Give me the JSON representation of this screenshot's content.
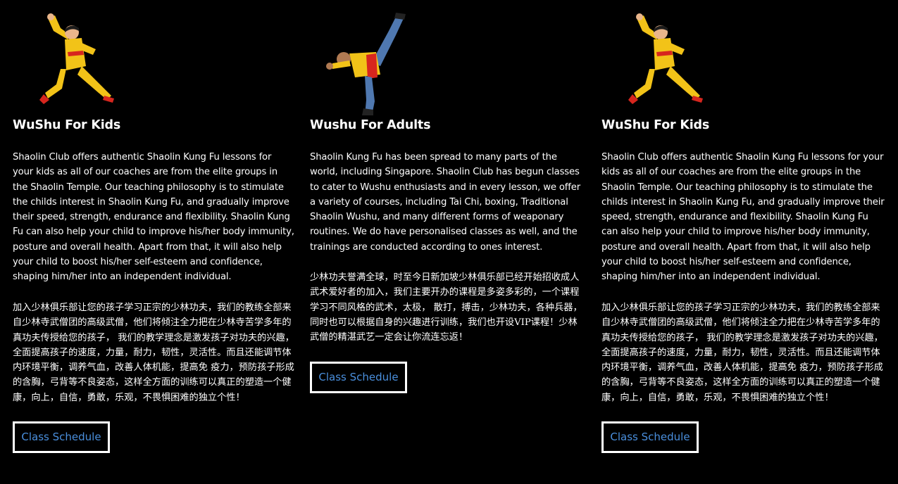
{
  "cards": [
    {
      "title": "WuShu For Kids",
      "description_en": "Shaolin Club offers authentic Shaolin Kung Fu lessons for your kids as all of our coaches are from the elite groups in the Shaolin Temple. Our teaching philosophy is to stimulate the childs interest in Shaolin Kung Fu, and gradually improve their speed, strength, endurance and flexibility. Shaolin Kung Fu can also help your child to improve his/her body immunity, posture and overall health. Apart from that, it will also help your child to boost his/her self-esteem and confidence, shaping him/her into an independent individual.",
      "description_zh": "加入少林俱乐部让您的孩子学习正宗的少林功夫，我们的教练全部来自少林寺武僧团的高级武僧，他们将倾注全力把在少林寺苦学多年的真功夫传授给您的孩子， 我们的教学理念是激发孩子对功夫的兴趣，全面提高孩子的速度，力量，耐力，韧性，灵活性。而且还能调节体内环境平衡，调养气血，改善人体机能，提高免 疫力，预防孩子形成的含胸，弓背等不良姿态，这样全方面的训练可以真正的塑造一个健康，向上，自信，勇敢，乐观，不畏惧困难的独立个性！",
      "button_label": "Class Schedule",
      "image": "kid-martial-artist-pose"
    },
    {
      "title": "Wushu For Adults",
      "description_en": "Shaolin Kung Fu has been spread to many parts of the world, including Singapore. Shaolin Club has begun classes to cater to Wushu enthusiasts and in every lesson, we offer a variety of courses, including Tai Chi, boxing, Traditional Shaolin Wushu, and many different forms of weaponary routines. We do have personalised classes as well, and the trainings are conducted according to ones interest.",
      "description_zh": "少林功夫誉满全球，时至今日新加坡少林俱乐部已经开始招收成人武术爱好者的加入，我们主要开办的课程是多姿多彩的，一个课程学习不同风格的武术，太极， 散打，搏击，少林功夫，各种兵器，同时也可以根据自身的兴趣进行训练，我们也开设VIP课程！少林武僧的精湛武艺一定会让你流连忘返！",
      "button_label": "Class Schedule",
      "image": "adult-high-kick"
    },
    {
      "title": "WuShu For Kids",
      "description_en": "Shaolin Club offers authentic Shaolin Kung Fu lessons for your kids as all of our coaches are from the elite groups in the Shaolin Temple. Our teaching philosophy is to stimulate the childs interest in Shaolin Kung Fu, and gradually improve their speed, strength, endurance and flexibility. Shaolin Kung Fu can also help your child to improve his/her body immunity, posture and overall health. Apart from that, it will also help your child to boost his/her self-esteem and confidence, shaping him/her into an independent individual.",
      "description_zh": "加入少林俱乐部让您的孩子学习正宗的少林功夫，我们的教练全部来自少林寺武僧团的高级武僧，他们将倾注全力把在少林寺苦学多年的真功夫传授给您的孩子， 我们的教学理念是激发孩子对功夫的兴趣，全面提高孩子的速度，力量，耐力，韧性，灵活性。而且还能调节体内环境平衡，调养气血，改善人体机能，提高免 疫力，预防孩子形成的含胸，弓背等不良姿态，这样全方面的训练可以真正的塑造一个健康，向上，自信，勇敢，乐观，不畏惧困难的独立个性！",
      "button_label": "Class Schedule",
      "image": "kid-martial-artist-pose"
    }
  ],
  "colors": {
    "background": "#000000",
    "text": "#ffffff",
    "button_text": "#4a8fdd",
    "button_border": "#ffffff",
    "uniform_yellow": "#f2c318",
    "uniform_red": "#d7261e"
  }
}
